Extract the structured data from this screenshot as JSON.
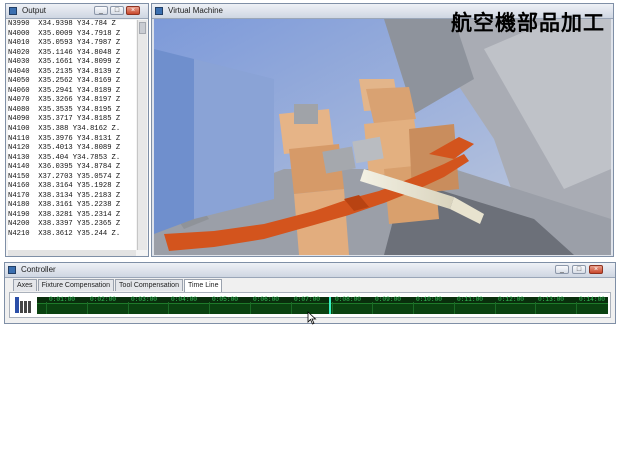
{
  "output": {
    "title": "Output",
    "lines": [
      "N3990  X34.9398 Y34.784 Z",
      "N4000  X35.0009 Y34.7918 Z",
      "N4010  X35.0593 Y34.7987 Z",
      "N4020  X35.1146 Y34.8048 Z",
      "N4030  X35.1661 Y34.8099 Z",
      "N4040  X35.2135 Y34.8139 Z",
      "N4050  X35.2562 Y34.8169 Z",
      "N4060  X35.2941 Y34.8189 Z",
      "N4070  X35.3266 Y34.8197 Z",
      "N4080  X35.3535 Y34.8195 Z",
      "N4090  X35.3717 Y34.8185 Z",
      "N4100  X35.388 Y34.8162 Z.",
      "N4110  X35.3976 Y34.8131 Z",
      "N4120  X35.4013 Y34.8089 Z",
      "N4130  X35.404 Y34.7853 Z.",
      "N4140  X36.0395 Y34.8784 Z",
      "N4150  X37.2703 Y35.0574 Z",
      "N4160  X38.3164 Y35.1928 Z",
      "N4170  X38.3134 Y35.2183 Z",
      "N4180  X38.3161 Y35.2238 Z",
      "N4190  X38.3281 Y35.2314 Z",
      "N4200  X38.3397 Y35.2365 Z",
      "N4210  X38.3612 Y35.244 Z."
    ]
  },
  "vm": {
    "title": "Virtual Machine",
    "overlay_text": "航空機部品加工"
  },
  "controller": {
    "title": "Controller",
    "tabs": [
      "Axes",
      "Fixture Compensation",
      "Tool Compensation",
      "Time Line"
    ],
    "active_tab": "Time Line",
    "timeline": {
      "ticks": [
        "0:01:00",
        "0:02:00",
        "0:03:00",
        "0:04:00",
        "0:05:00",
        "0:06:00",
        "0:07:00",
        "0:08:00",
        "0:09:00",
        "0:10:00",
        "0:11:00",
        "0:12:00",
        "0:13:00",
        "0:14:00"
      ],
      "current_time": "0:08:00"
    }
  },
  "window_buttons": {
    "minimize": "_",
    "maximize": "□",
    "close": "×"
  },
  "colors": {
    "timeline_bg": "#0a4210",
    "timeline_text": "#35c35a",
    "marker": "#39f3c6",
    "part_orange": "#d3541d"
  }
}
